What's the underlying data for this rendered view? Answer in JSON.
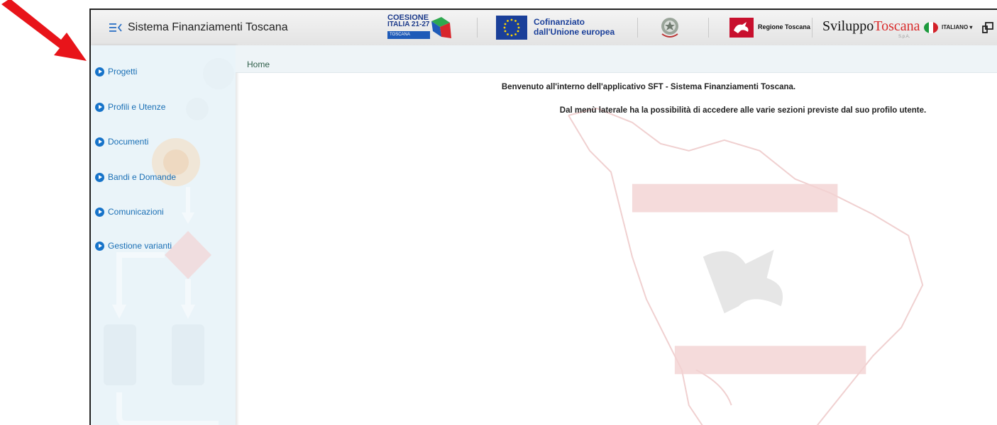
{
  "header": {
    "app_title": "Sistema Finanziamenti Toscana",
    "coesione_line1": "COESIONE",
    "coesione_line2": "ITALIA 21-27",
    "coesione_tag": "TOSCANA",
    "eu_line1": "Cofinanziato",
    "eu_line2": "dall'Unione europea",
    "regione": "Regione Toscana",
    "sviluppo_a": "Sviluppo",
    "sviluppo_b": "Toscana",
    "sviluppo_spa": "S.p.A.",
    "language": "ITALIANO"
  },
  "sidebar": {
    "items": [
      {
        "label": "Progetti"
      },
      {
        "label": "Profili e Utenze"
      },
      {
        "label": "Documenti"
      },
      {
        "label": "Bandi e Domande"
      },
      {
        "label": "Comunicazioni"
      },
      {
        "label": "Gestione varianti"
      }
    ]
  },
  "breadcrumb": "Home",
  "main": {
    "welcome_line1": "Benvenuto all'interno dell'applicativo SFT - Sistema Finanziamenti Toscana.",
    "welcome_line2": "Dal menù laterale ha la possibilità di accedere alle varie sezioni previste dal suo profilo utente."
  },
  "colors": {
    "accent": "#1673c9",
    "annotation_arrow": "#e8141a"
  }
}
